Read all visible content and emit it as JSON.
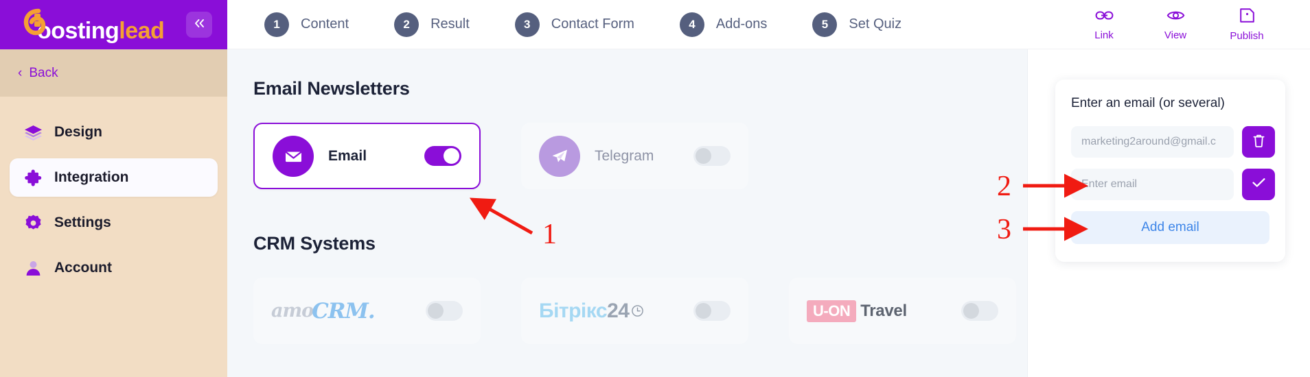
{
  "brand": {
    "name_white": "oosting",
    "name_orange": "lead",
    "logo_icon": "boostinglead-logo-icon",
    "bg_color": "#8a0ed8",
    "accent_orange": "#f5a033"
  },
  "sidebar": {
    "collapse_icon": "double-chevron-left-icon",
    "back": {
      "label": "Back",
      "icon": "chevron-left-icon"
    },
    "items": [
      {
        "label": "Design",
        "icon": "layers-icon",
        "active": false
      },
      {
        "label": "Integration",
        "icon": "puzzle-icon",
        "active": true
      },
      {
        "label": "Settings",
        "icon": "gear-icon",
        "active": false
      },
      {
        "label": "Account",
        "icon": "user-icon",
        "active": false
      }
    ]
  },
  "topbar": {
    "steps": [
      {
        "number": "1",
        "label": "Content"
      },
      {
        "number": "2",
        "label": "Result"
      },
      {
        "number": "3",
        "label": "Contact Form"
      },
      {
        "number": "4",
        "label": "Add-ons"
      },
      {
        "number": "5",
        "label": "Set Quiz"
      }
    ],
    "actions": [
      {
        "label": "Link",
        "icon": "link-chain-icon"
      },
      {
        "label": "View",
        "icon": "eye-icon"
      },
      {
        "label": "Publish",
        "icon": "save-disk-icon"
      }
    ]
  },
  "main": {
    "newsletters_title": "Email Newsletters",
    "crm_title": "CRM Systems",
    "integrations": [
      {
        "name": "Email",
        "icon": "envelope-icon",
        "enabled": true,
        "selected": true
      },
      {
        "name": "Telegram",
        "icon": "paper-plane-icon",
        "enabled": false,
        "selected": false
      }
    ],
    "crm_systems": [
      {
        "name": "amoCRM",
        "logo_part_1": "amo",
        "logo_part_2": "CRM.",
        "enabled": false
      },
      {
        "name": "Bitrix24",
        "logo_part_1": "Бітрікс",
        "logo_part_2": "24",
        "logo_icon": "clock-icon",
        "enabled": false
      },
      {
        "name": "U-ON Travel",
        "logo_part_1": "U-ON",
        "logo_part_2": "Travel",
        "enabled": false
      }
    ]
  },
  "email_panel": {
    "title": "Enter an email (or several)",
    "existing_email": "marketing2around@gmail.c",
    "delete_icon": "trash-icon",
    "new_email_placeholder": "Enter email",
    "confirm_icon": "checkmark-icon",
    "add_email_label": "Add email"
  },
  "annotations": [
    {
      "number": "1",
      "target": "email-integration-card"
    },
    {
      "number": "2",
      "target": "new-email-input"
    },
    {
      "number": "3",
      "target": "add-email-button"
    }
  ]
}
